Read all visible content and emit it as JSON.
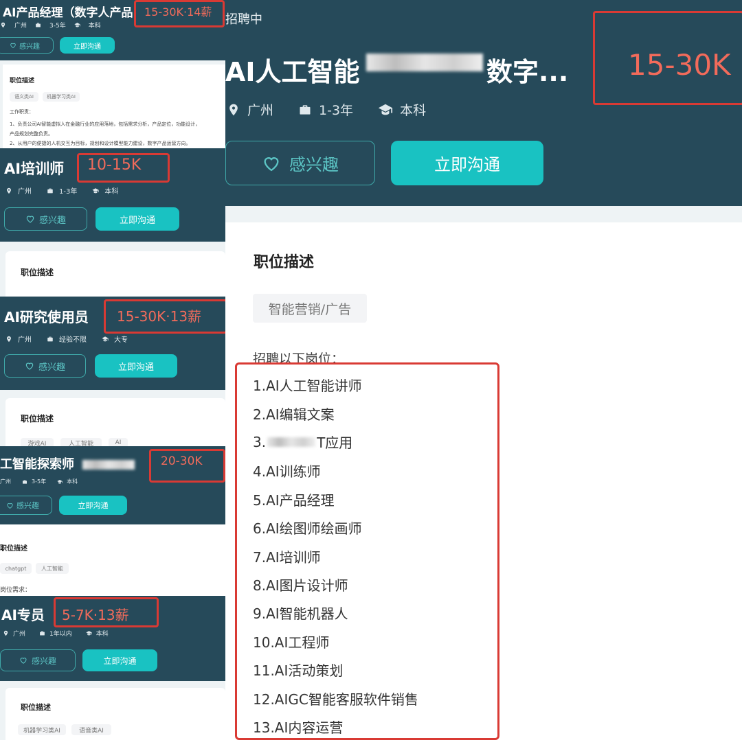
{
  "common": {
    "city": "广州",
    "interested": "感兴趣",
    "chat": "立即沟通",
    "job_desc": "职位描述"
  },
  "card1": {
    "title": "AI产品经理（数字人产品...",
    "salary": "15-30K·14薪",
    "exp": "3-5年",
    "edu": "本科",
    "tags": [
      "语义类AI",
      "机器学习类AI"
    ],
    "body_lines": [
      "工作职责：",
      "1、负责公司AI智能虚拟人在金融行业的应用落地，包括需求分析，产品定位，功能设计，",
      "产品规划完整负责。",
      "2、从用户的便捷的人机交互为目标，规划和设计模型能力建设，数字产品运营方向。"
    ]
  },
  "card2": {
    "title": "AI培训师",
    "salary": "10-15K",
    "exp": "1-3年",
    "edu": "本科"
  },
  "card3": {
    "title": "AI研究使用员",
    "salary": "15-30K·13薪",
    "exp": "经验不限",
    "edu": "大专",
    "tags": [
      "游戏AI",
      "人工智能",
      "AI"
    ]
  },
  "card4": {
    "title": "工智能探索师",
    "salary": "20-30K",
    "exp": "3-5年",
    "edu": "本科",
    "tags": [
      "chatgpt",
      "人工智能"
    ],
    "req": "岗位需求："
  },
  "card5": {
    "title": "AI专员",
    "salary": "5-7K·13薪",
    "exp": "1年以内",
    "edu": "本科",
    "tags": [
      "机器学习类AI",
      "语音类AI"
    ]
  },
  "main": {
    "status": "招聘中",
    "title_prefix": "AI人工智能",
    "title_suffix": "数字...",
    "salary": "15-30K",
    "exp": "1-3年",
    "edu": "本科",
    "tag": "智能营销/广告",
    "intro": "招聘以下岗位：",
    "positions": [
      "1.AI人工智能讲师",
      "2.AI编辑文案",
      "3.",
      "4.AI训练师",
      "5.AI产品经理",
      "6.AI绘图师绘画师",
      "7.AI培训师",
      "8.AI图片设计师",
      "9.AI智能机器人",
      "10.AI工程师",
      "11.AI活动策划",
      "12.AIGC智能客服软件销售",
      "13.AI内容运营"
    ],
    "position3_tail": "T应用"
  },
  "colors": {
    "header": "#264a5a",
    "accent": "#19c2c2",
    "salary": "#f26b5b",
    "highlight": "#d93a34"
  },
  "icons": [
    "location-icon",
    "briefcase-icon",
    "graduation-cap-icon",
    "heart-icon"
  ]
}
